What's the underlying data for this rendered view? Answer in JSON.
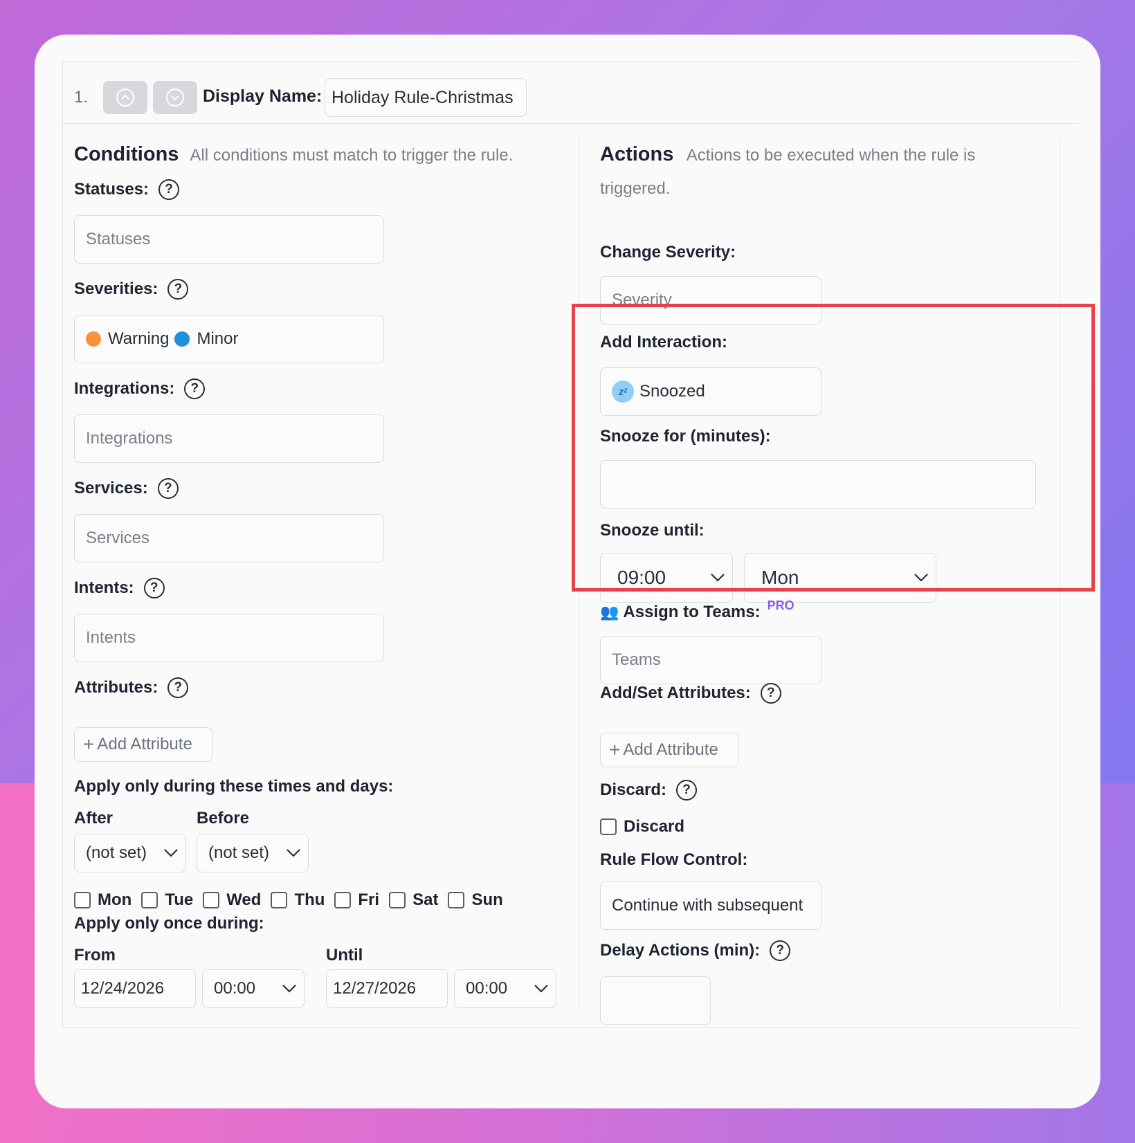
{
  "rule": {
    "number": "1.",
    "display_name_label": "Display Name:",
    "display_name_value": "Holiday Rule-Christmas"
  },
  "conditions": {
    "title": "Conditions",
    "description": "All conditions must match to trigger the rule.",
    "statuses_label": "Statuses:",
    "statuses_placeholder": "Statuses",
    "severities_label": "Severities:",
    "severities": [
      {
        "label": "Warning",
        "color": "#f7913a"
      },
      {
        "label": "Minor",
        "color": "#1e8fd8"
      }
    ],
    "integrations_label": "Integrations:",
    "integrations_placeholder": "Integrations",
    "services_label": "Services:",
    "services_placeholder": "Services",
    "intents_label": "Intents:",
    "intents_placeholder": "Intents",
    "attributes_label": "Attributes:",
    "add_attribute": "Add Attribute",
    "times_title": "Apply only during these times and days:",
    "after_label": "After",
    "after_value": "(not set)",
    "before_label": "Before",
    "before_value": "(not set)",
    "days": [
      "Mon",
      "Tue",
      "Wed",
      "Thu",
      "Fri",
      "Sat",
      "Sun"
    ],
    "once_title": "Apply only once during:",
    "from_label": "From",
    "from_date": "12/24/2026",
    "from_time": "00:00",
    "until_label": "Until",
    "until_date": "12/27/2026",
    "until_time": "00:00"
  },
  "actions": {
    "title": "Actions",
    "description_line1": "Actions to be executed when the rule is",
    "description_line2": "triggered.",
    "change_severity_label": "Change Severity:",
    "severity_placeholder": "Severity",
    "add_interaction_label": "Add Interaction:",
    "interaction_value": "Snoozed",
    "snooze_for_label": "Snooze for (minutes):",
    "snooze_for_value": "",
    "snooze_until_label": "Snooze until:",
    "snooze_until_time": "09:00",
    "snooze_until_day": "Mon",
    "assign_teams_label": "Assign to Teams:",
    "pro_badge": "PRO",
    "teams_placeholder": "Teams",
    "add_set_attributes_label": "Add/Set Attributes:",
    "add_attribute": "Add Attribute",
    "discard_label": "Discard:",
    "discard_checkbox_label": "Discard",
    "flow_control_label": "Rule Flow Control:",
    "flow_control_value": "Continue with subsequent",
    "delay_actions_label": "Delay Actions (min):",
    "delay_actions_value": ""
  },
  "icons": {
    "move_up": "chevron-up-circle-icon",
    "move_down": "chevron-down-circle-icon",
    "help": "question-circle-icon",
    "snooze": "zzz-icon",
    "teams": "people-icon"
  },
  "colors": {
    "highlight": "#e8414b",
    "pro": "#8a5be8"
  }
}
